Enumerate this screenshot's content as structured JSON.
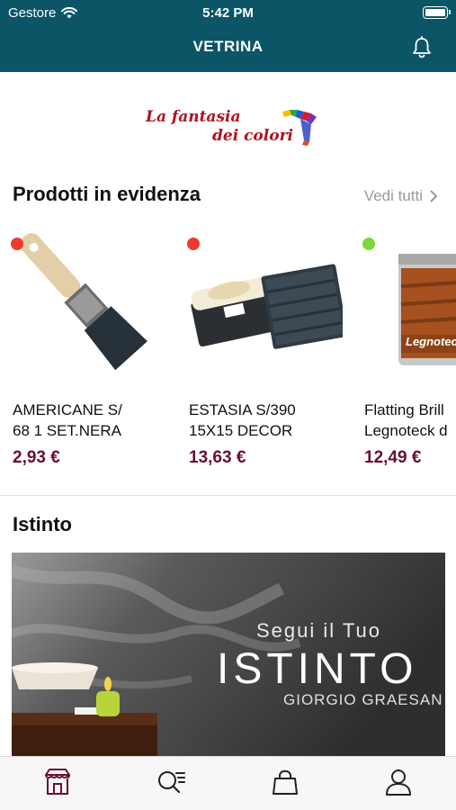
{
  "status_bar": {
    "carrier": "Gestore",
    "time": "5:42 PM"
  },
  "nav": {
    "title": "VETRINA"
  },
  "logo": {
    "line1": "La fantasia",
    "line2": "dei colori"
  },
  "featured": {
    "title": "Prodotti in evidenza",
    "see_all": "Vedi tutti",
    "products": [
      {
        "name": "AMERICANE S/\n68 1 SET.NERA",
        "price": "2,93 €",
        "availability_color": "#f03a2e"
      },
      {
        "name": "ESTASIA S/390\n15X15 DECOR",
        "price": "13,63 €",
        "availability_color": "#f03a2e"
      },
      {
        "name": "Flatting Brill\nLegnoteck d",
        "price": "12,49 €",
        "availability_color": "#7dd63a",
        "can_label": "Legnoteck"
      }
    ]
  },
  "istinto": {
    "title": "Istinto",
    "banner_line1": "Segui il Tuo",
    "banner_line2": "ISTINTO",
    "banner_line3": "GIORGIO GRAESAN"
  },
  "colors": {
    "header": "#0b5566",
    "price": "#6b0f2a",
    "tab_active": "#6b0f2a"
  },
  "tabs": [
    {
      "icon": "store-icon",
      "active": true
    },
    {
      "icon": "search-list-icon",
      "active": false
    },
    {
      "icon": "shopping-bag-icon",
      "active": false
    },
    {
      "icon": "user-icon",
      "active": false
    }
  ]
}
